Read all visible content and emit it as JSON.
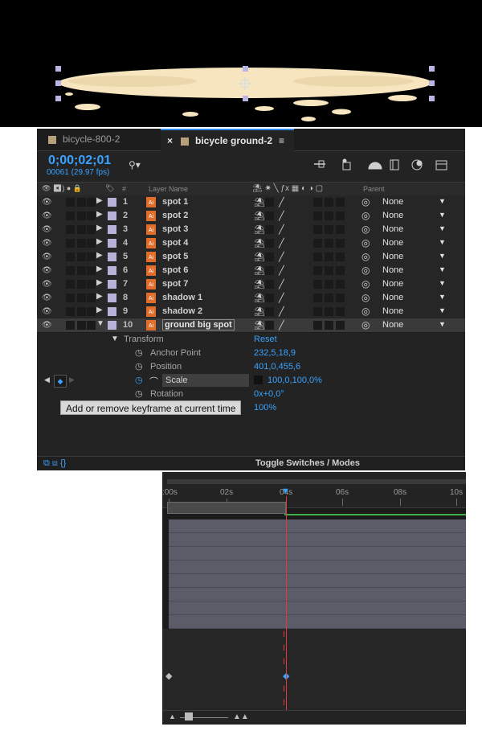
{
  "tabs": [
    {
      "label": "bicycle-800-2"
    },
    {
      "label": "bicycle ground-2",
      "close": "×",
      "menu": "≡"
    }
  ],
  "timecode": "0;00;02;01",
  "frames": "00061 (29.97 fps)",
  "columns": {
    "layer_name": "Layer Name",
    "hash": "#",
    "parent": "Parent"
  },
  "layers": [
    {
      "num": "1",
      "name": "spot 1",
      "parent": "None"
    },
    {
      "num": "2",
      "name": "spot 2",
      "parent": "None"
    },
    {
      "num": "3",
      "name": "spot 3",
      "parent": "None"
    },
    {
      "num": "4",
      "name": "spot 4",
      "parent": "None"
    },
    {
      "num": "5",
      "name": "spot 5",
      "parent": "None"
    },
    {
      "num": "6",
      "name": "spot 6",
      "parent": "None"
    },
    {
      "num": "7",
      "name": "spot 7",
      "parent": "None"
    },
    {
      "num": "8",
      "name": "shadow 1",
      "parent": "None"
    },
    {
      "num": "9",
      "name": "shadow 2",
      "parent": "None"
    },
    {
      "num": "10",
      "name": "ground big spot",
      "parent": "None"
    }
  ],
  "transform": {
    "label": "Transform",
    "reset": "Reset",
    "anchor_point": {
      "label": "Anchor Point",
      "value": "232,5,18,9"
    },
    "position": {
      "label": "Position",
      "value": "401,0,455,6"
    },
    "scale": {
      "label": "Scale",
      "value": "100,0,100,0%"
    },
    "rotation": {
      "label": "Rotation",
      "value": "0x+0,0°"
    },
    "opacity": {
      "value": "100%"
    }
  },
  "tooltip": "Add or remove keyframe at current time",
  "footer": {
    "toggle": "Toggle Switches / Modes"
  },
  "ruler": {
    "labels": [
      ":00s",
      "02s",
      "04s",
      "06s",
      "08s",
      "10s"
    ]
  },
  "colors": {
    "accent": "#3aa2ff",
    "playhead": "#e0393e",
    "ellipse": "#f6e5bf"
  }
}
